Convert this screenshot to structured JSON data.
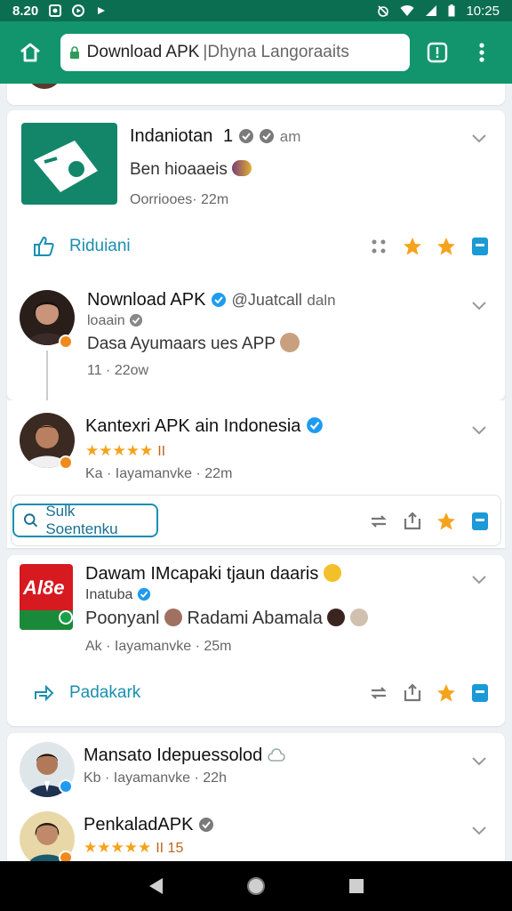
{
  "status_bar": {
    "left_text": "8.20",
    "time": "10:25"
  },
  "toolbar": {
    "url_main": "Download APK",
    "url_rest": "|Dhyna Langoraaits"
  },
  "cards": [
    {
      "app_name": "Indaniotan",
      "app_suffix": "1",
      "app_tag": "am",
      "desc": "Ben hioaaeis",
      "meta": "Oorriooes· 22m",
      "action_label": "Riduiani"
    },
    {
      "name": "Nownload APK",
      "handle": "@Juatcall",
      "handle_suffix": "daln",
      "sub_handle": "loaain",
      "text": "Dasa Ayumaars ues APP",
      "meta": "11 · 22ow"
    },
    {
      "name": "Kantexri APK ain Indonesia",
      "stars_count": "II",
      "meta": "Ka · Iayamanvke · 22m",
      "search_label": "Sulk Soentenku"
    },
    {
      "name": "Dawam IMcapaki tjaun daaris",
      "logo_text": "Al8e",
      "handle": "Inatuba",
      "text": "Poonyanl",
      "text2": "Radami Abamala",
      "meta": "Ak · Iayamanvke · 25m",
      "action_label": "Padakark"
    },
    {
      "name": "Mansato Idepuessolod",
      "meta": "Kb · Iayamanvke · 22h"
    },
    {
      "name": "PenkaladAPK",
      "stars_count": "II 15"
    }
  ]
}
